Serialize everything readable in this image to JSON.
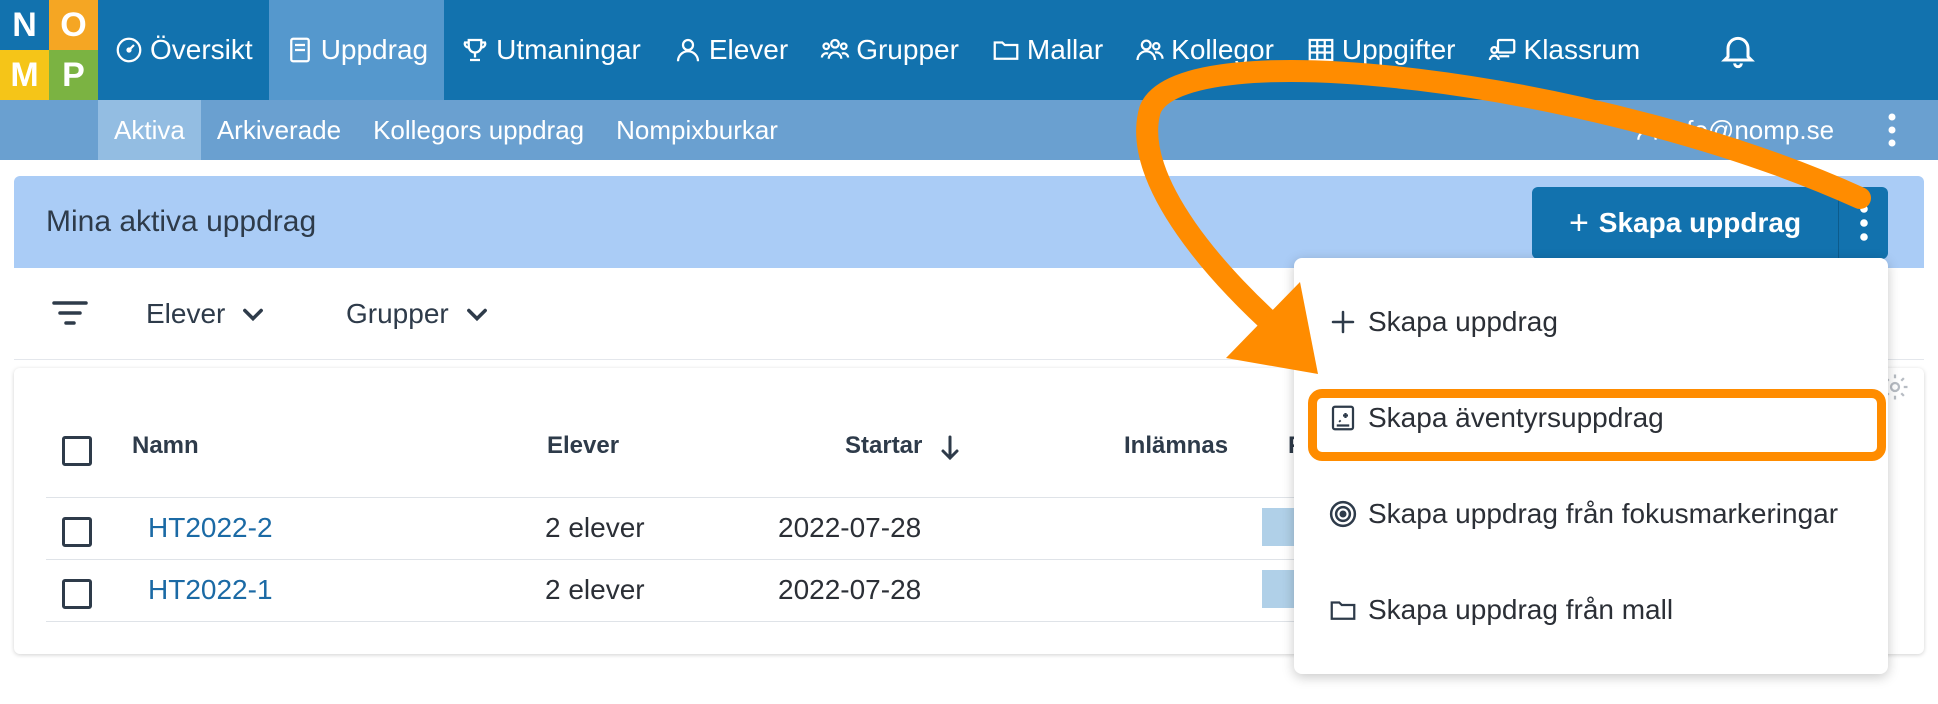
{
  "logo": {
    "letters": [
      "N",
      "O",
      "M",
      "P"
    ],
    "colors": [
      "#1272ae",
      "#f5a623",
      "#f5c518",
      "#7bb342"
    ]
  },
  "nav": {
    "items": [
      {
        "label": "Översikt",
        "icon": "speedometer-icon"
      },
      {
        "label": "Uppdrag",
        "icon": "book-icon",
        "active": true
      },
      {
        "label": "Utmaningar",
        "icon": "trophy-icon"
      },
      {
        "label": "Elever",
        "icon": "person-icon"
      },
      {
        "label": "Grupper",
        "icon": "people-icon"
      },
      {
        "label": "Mallar",
        "icon": "folder-icon"
      },
      {
        "label": "Kollegor",
        "icon": "two-people-icon"
      },
      {
        "label": "Uppgifter",
        "icon": "grid-icon"
      },
      {
        "label": "Klassrum",
        "icon": "classroom-icon"
      }
    ],
    "bell_icon": "bell-icon"
  },
  "subnav": {
    "items": [
      {
        "label": "Aktiva",
        "active": true
      },
      {
        "label": "Arkiverade"
      },
      {
        "label": "Kollegors uppdrag"
      },
      {
        "label": "Nompixburkar"
      }
    ],
    "user_email": "info@nomp.se"
  },
  "panel": {
    "title": "Mina aktiva uppdrag",
    "create_button": "Skapa uppdrag"
  },
  "filters": {
    "students": "Elever",
    "groups": "Grupper"
  },
  "table": {
    "headers": {
      "name": "Namn",
      "students": "Elever",
      "start": "Startar",
      "submitted": "Inlämnas",
      "progress": "F"
    },
    "rows": [
      {
        "name": "HT2022-2",
        "students": "2 elever",
        "start": "2022-07-28"
      },
      {
        "name": "HT2022-1",
        "students": "2 elever",
        "start": "2022-07-28"
      }
    ]
  },
  "dropdown": {
    "items": [
      {
        "label": "Skapa uppdrag",
        "icon": "plus-icon"
      },
      {
        "label": "Skapa äventyrsuppdrag",
        "icon": "adventure-book-icon",
        "highlighted": true
      },
      {
        "label": "Skapa uppdrag från fokusmarkeringar",
        "icon": "target-icon"
      },
      {
        "label": "Skapa uppdrag från mall",
        "icon": "folder-icon"
      }
    ]
  },
  "colors": {
    "nav_bg": "#1272ae",
    "subnav_bg": "#6aa0d0",
    "panel_header_bg": "#aaccf6",
    "annotation": "#ff8c00",
    "link": "#1b6aa5"
  }
}
